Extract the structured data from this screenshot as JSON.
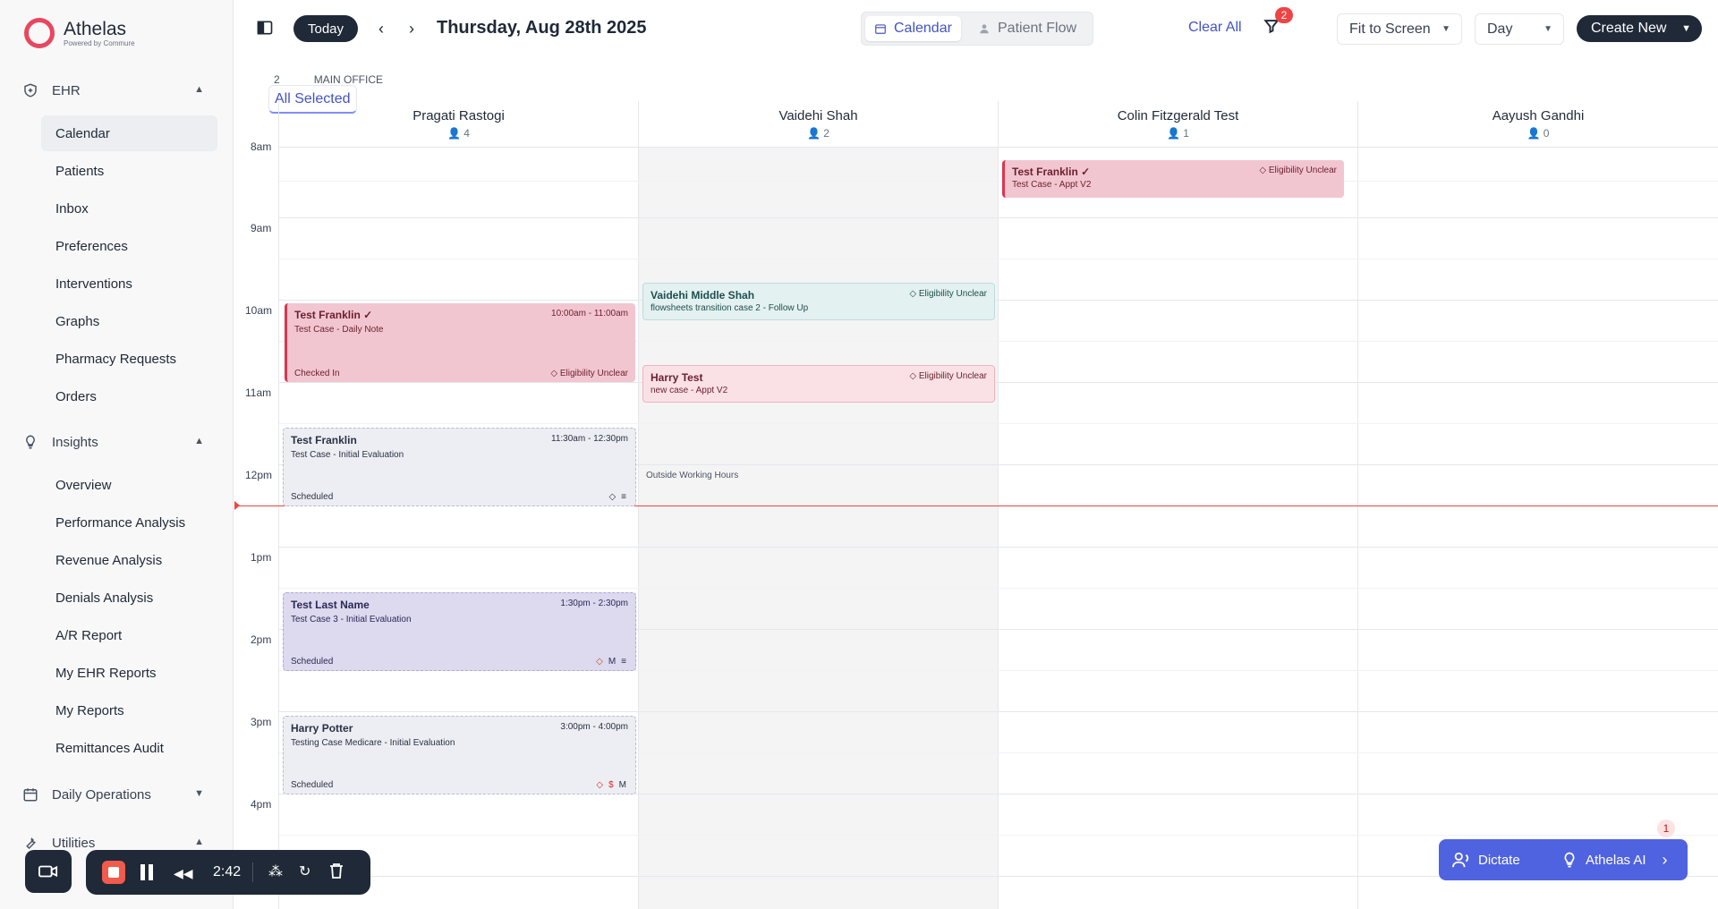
{
  "app": {
    "name": "Athelas",
    "tagline": "Powered by Commure"
  },
  "sidebar": {
    "ehr": {
      "label": "EHR",
      "items": [
        "Calendar",
        "Patients",
        "Inbox",
        "Preferences",
        "Interventions",
        "Graphs",
        "Pharmacy Requests",
        "Orders"
      ],
      "active": "Calendar"
    },
    "insights": {
      "label": "Insights",
      "items": [
        "Overview",
        "Performance Analysis",
        "Revenue Analysis",
        "Denials Analysis",
        "A/R Report",
        "My EHR Reports",
        "My Reports",
        "Remittances Audit"
      ]
    },
    "daily_ops": {
      "label": "Daily Operations"
    },
    "utilities": {
      "label": "Utilities"
    }
  },
  "header": {
    "today": "Today",
    "date": "Thursday, Aug 28th 2025",
    "view_calendar": "Calendar",
    "view_patient_flow": "Patient Flow",
    "clear_all": "Clear All",
    "filter_count": "2",
    "fit": "Fit to Screen",
    "range": "Day",
    "create": "Create New"
  },
  "subtabs": [
    "All Selected",
    "2",
    "MAIN OFFICE"
  ],
  "columns": [
    {
      "name": "Pragati Rastogi",
      "count": "4"
    },
    {
      "name": "Vaidehi Shah",
      "count": "2"
    },
    {
      "name": "Colin Fitzgerald Test",
      "count": "1"
    },
    {
      "name": "Aayush Gandhi",
      "count": "0"
    }
  ],
  "times": [
    "8am",
    "9am",
    "10am",
    "11am",
    "12pm",
    "1pm",
    "2pm",
    "3pm",
    "4pm"
  ],
  "events": {
    "e1": {
      "title": "Test Franklin ✓",
      "sub": "Test Case - Daily Note",
      "time": "10:00am - 11:00am",
      "status": "Checked In",
      "elig": "Eligibility Unclear"
    },
    "e2": {
      "title": "Test Franklin",
      "sub": "Test Case - Initial Evaluation",
      "time": "11:30am - 12:30pm",
      "status": "Scheduled"
    },
    "e3": {
      "title": "Test Last Name",
      "sub": "Test Case 3 - Initial Evaluation",
      "time": "1:30pm - 2:30pm",
      "status": "Scheduled",
      "icons": "M"
    },
    "e4": {
      "title": "Harry Potter",
      "sub": "Testing Case Medicare - Initial Evaluation",
      "time": "3:00pm - 4:00pm",
      "status": "Scheduled",
      "icon_dollar": "$",
      "icon_m": "M"
    },
    "e5": {
      "title": "Vaidehi Middle Shah",
      "sub": "flowsheets transition case 2 - Follow Up",
      "elig": "Eligibility Unclear"
    },
    "e6": {
      "title": "Harry Test",
      "sub": "new case - Appt V2",
      "elig": "Eligibility Unclear"
    },
    "e7": {
      "title": "Test Franklin ✓",
      "sub": "Test Case - Appt V2",
      "elig": "Eligibility Unclear"
    }
  },
  "outside_hours": "Outside Working Hours",
  "recorder": {
    "time": "2:42"
  },
  "ai": {
    "dictate": "Dictate",
    "athelas_ai": "Athelas AI",
    "badge": "1"
  }
}
